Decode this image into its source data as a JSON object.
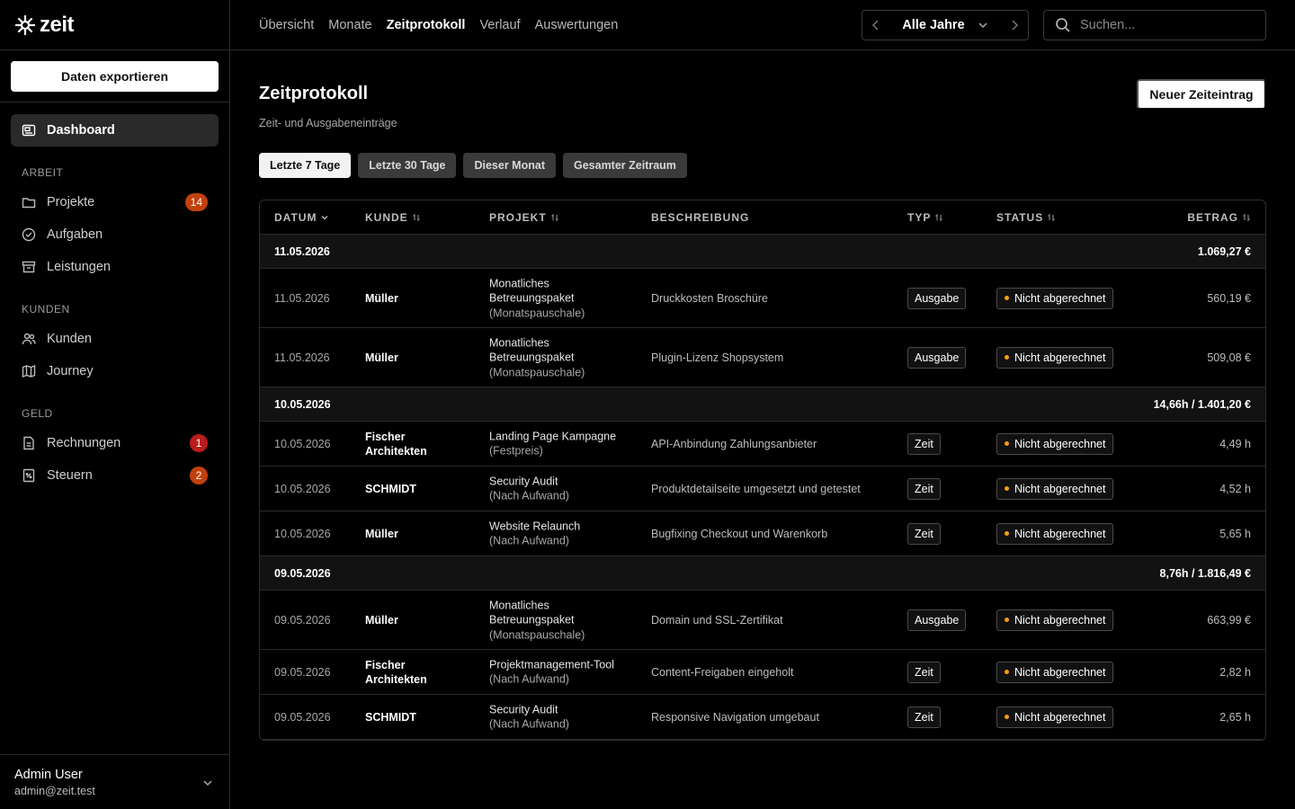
{
  "brand": {
    "name": "zeit"
  },
  "sidebar": {
    "export_label": "Daten exportieren",
    "dashboard": "Dashboard",
    "sections": {
      "arbeit": "ARBEIT",
      "kunden": "KUNDEN",
      "geld": "GELD"
    },
    "items": {
      "projekte": {
        "label": "Projekte",
        "badge": "14"
      },
      "aufgaben": {
        "label": "Aufgaben"
      },
      "leistungen": {
        "label": "Leistungen"
      },
      "kunden": {
        "label": "Kunden"
      },
      "journey": {
        "label": "Journey"
      },
      "rechnungen": {
        "label": "Rechnungen",
        "badge": "1"
      },
      "steuern": {
        "label": "Steuern",
        "badge": "2"
      }
    },
    "user": {
      "name": "Admin User",
      "email": "admin@zeit.test"
    }
  },
  "topnav": {
    "items": [
      "Übersicht",
      "Monate",
      "Zeitprotokoll",
      "Verlauf",
      "Auswertungen"
    ],
    "active": "Zeitprotokoll",
    "year": "Alle Jahre",
    "search_placeholder": "Suchen..."
  },
  "page": {
    "title": "Zeitprotokoll",
    "subtitle": "Zeit- und Ausgabeneinträge",
    "new_button": "Neuer Zeiteintrag",
    "filters": [
      "Letzte 7 Tage",
      "Letzte 30 Tage",
      "Dieser Monat",
      "Gesamter Zeitraum"
    ],
    "active_filter": "Letzte 7 Tage"
  },
  "table": {
    "headers": {
      "datum": "DATUM",
      "kunde": "KUNDE",
      "projekt": "PROJEKT",
      "beschreibung": "BESCHREIBUNG",
      "typ": "TYP",
      "status": "STATUS",
      "betrag": "BETRAG"
    },
    "groups": [
      {
        "date": "11.05.2026",
        "sum": "1.069,27 €",
        "rows": [
          {
            "date": "11.05.2026",
            "kunde": "Müller",
            "projekt": "Monatliches Betreuungspaket",
            "projekt_sub": "(Monatspauschale)",
            "beschreibung": "Druckkosten Broschüre",
            "typ": "Ausgabe",
            "status": "Nicht abgerechnet",
            "betrag": "560,19 €"
          },
          {
            "date": "11.05.2026",
            "kunde": "Müller",
            "projekt": "Monatliches Betreuungspaket",
            "projekt_sub": "(Monatspauschale)",
            "beschreibung": "Plugin-Lizenz Shopsystem",
            "typ": "Ausgabe",
            "status": "Nicht abgerechnet",
            "betrag": "509,08 €"
          }
        ]
      },
      {
        "date": "10.05.2026",
        "sum": "14,66h / 1.401,20 €",
        "rows": [
          {
            "date": "10.05.2026",
            "kunde": "Fischer Architekten",
            "projekt": "Landing Page Kampagne",
            "projekt_sub": "(Festpreis)",
            "beschreibung": "API-Anbindung Zahlungsanbieter",
            "typ": "Zeit",
            "status": "Nicht abgerechnet",
            "betrag": "4,49 h"
          },
          {
            "date": "10.05.2026",
            "kunde": "SCHMIDT",
            "projekt": "Security Audit",
            "projekt_sub": "(Nach Aufwand)",
            "beschreibung": "Produktdetailseite umgesetzt und getestet",
            "typ": "Zeit",
            "status": "Nicht abgerechnet",
            "betrag": "4,52 h"
          },
          {
            "date": "10.05.2026",
            "kunde": "Müller",
            "projekt": "Website Relaunch",
            "projekt_sub": "(Nach Aufwand)",
            "beschreibung": "Bugfixing Checkout und Warenkorb",
            "typ": "Zeit",
            "status": "Nicht abgerechnet",
            "betrag": "5,65 h"
          }
        ]
      },
      {
        "date": "09.05.2026",
        "sum": "8,76h / 1.816,49 €",
        "rows": [
          {
            "date": "09.05.2026",
            "kunde": "Müller",
            "projekt": "Monatliches Betreuungspaket",
            "projekt_sub": "(Monatspauschale)",
            "beschreibung": "Domain und SSL-Zertifikat",
            "typ": "Ausgabe",
            "status": "Nicht abgerechnet",
            "betrag": "663,99 €"
          },
          {
            "date": "09.05.2026",
            "kunde": "Fischer Architekten",
            "projekt": "Projektmanagement-Tool",
            "projekt_sub": "(Nach Aufwand)",
            "beschreibung": "Content-Freigaben eingeholt",
            "typ": "Zeit",
            "status": "Nicht abgerechnet",
            "betrag": "2,82 h"
          },
          {
            "date": "09.05.2026",
            "kunde": "SCHMIDT",
            "projekt": "Security Audit",
            "projekt_sub": "(Nach Aufwand)",
            "beschreibung": "Responsive Navigation umgebaut",
            "typ": "Zeit",
            "status": "Nicht abgerechnet",
            "betrag": "2,65 h"
          }
        ]
      }
    ]
  },
  "colors": {
    "accent_orange": "#c2410c",
    "accent_red": "#b91c1c",
    "status_dot": "#f59e0b"
  }
}
